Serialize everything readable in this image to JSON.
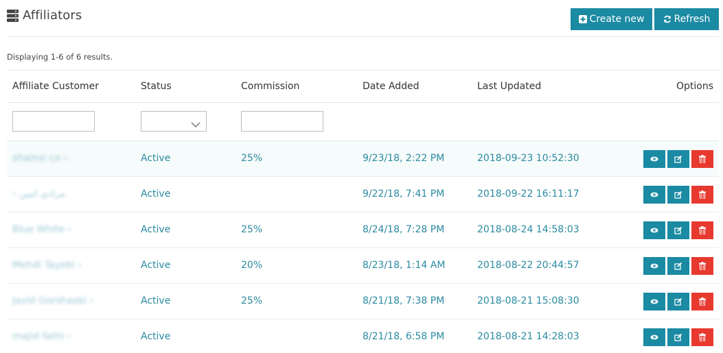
{
  "header": {
    "title": "Affiliators",
    "create_label": "Create new",
    "refresh_label": "Refresh"
  },
  "summary": "Displaying 1-6 of 6 results.",
  "columns": [
    "Affiliate Customer",
    "Status",
    "Commission",
    "Date Added",
    "Last Updated",
    "Options"
  ],
  "filters": {
    "customer_value": "",
    "status_value": "",
    "commission_value": ""
  },
  "rows": [
    {
      "customer": "shamsi co ›",
      "status": "Active",
      "commission": "25%",
      "date_added": "9/23/18, 2:22 PM",
      "last_updated": "2018-09-23 10:52:30"
    },
    {
      "customer": "› مرادی امین",
      "status": "Active",
      "commission": "",
      "date_added": "9/22/18, 7:41 PM",
      "last_updated": "2018-09-22 16:11:17"
    },
    {
      "customer": "Blue White ›",
      "status": "Active",
      "commission": "25%",
      "date_added": "8/24/18, 7:28 PM",
      "last_updated": "2018-08-24 14:58:03"
    },
    {
      "customer": "Mehdi Tayebi ›",
      "status": "Active",
      "commission": "20%",
      "date_added": "8/23/18, 1:14 AM",
      "last_updated": "2018-08-22 20:44:57"
    },
    {
      "customer": "Javid Gorshasbi ›",
      "status": "Active",
      "commission": "25%",
      "date_added": "8/21/18, 7:38 PM",
      "last_updated": "2018-08-21 15:08:30"
    },
    {
      "customer": "majid fathi ›",
      "status": "Active",
      "commission": "",
      "date_added": "8/21/18, 6:58 PM",
      "last_updated": "2018-08-21 14:28:03"
    }
  ],
  "colors": {
    "accent": "#1b8aa3",
    "danger": "#e8392f",
    "link": "#2a8aa0"
  },
  "icons": {
    "title": "server-list-icon",
    "create": "plus-square-icon",
    "refresh": "refresh-icon",
    "view": "eye-icon",
    "edit": "edit-icon",
    "delete": "trash-icon"
  }
}
